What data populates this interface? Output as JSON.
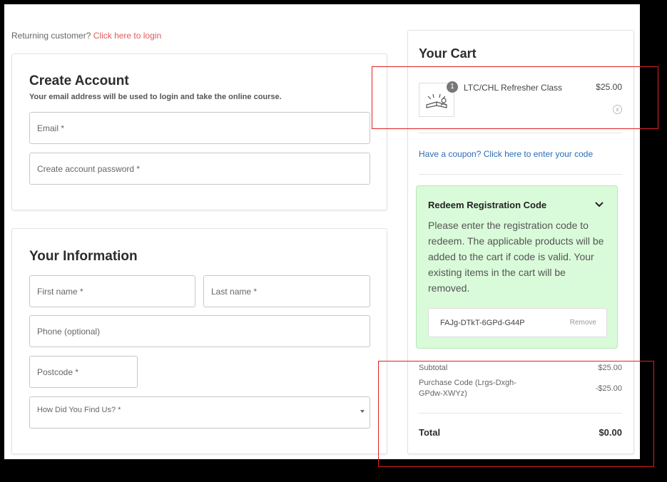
{
  "returning": {
    "text": "Returning customer?",
    "link": "Click here to login"
  },
  "create_account": {
    "title": "Create Account",
    "subtitle": "Your email address will be used to login and take the online course.",
    "email_label": "Email *",
    "password_label": "Create account password *"
  },
  "your_info": {
    "title": "Your Information",
    "first_name_label": "First name *",
    "last_name_label": "Last name *",
    "phone_label": "Phone (optional)",
    "postcode_label": "Postcode *",
    "how_found_label": "How Did You Find Us? *"
  },
  "cart": {
    "title": "Your Cart",
    "item": {
      "qty": "1",
      "name": "LTC/CHL Refresher Class",
      "price": "$25.00",
      "remove": "x"
    },
    "coupon_link": "Have a coupon? Click here to enter your code",
    "redeem": {
      "title": "Redeem Registration Code",
      "text": "Please enter the registration code to redeem. The applicable products will be added to the cart if code is valid. Your existing items in the cart will be removed.",
      "code": "FAJg-DTkT-6GPd-G44P",
      "remove_label": "Remove"
    },
    "subtotal_label": "Subtotal",
    "subtotal_value": "$25.00",
    "purchase_code_label": "Purchase Code (Lrgs-Dxgh-GPdw-XWYz)",
    "purchase_code_value": "-$25.00",
    "total_label": "Total",
    "total_value": "$0.00"
  },
  "colors": {
    "accent_link": "#e05a5a",
    "coupon_link": "#2a6db5",
    "redeem_bg": "#d9fbd9",
    "highlight": "#e01f1f"
  }
}
